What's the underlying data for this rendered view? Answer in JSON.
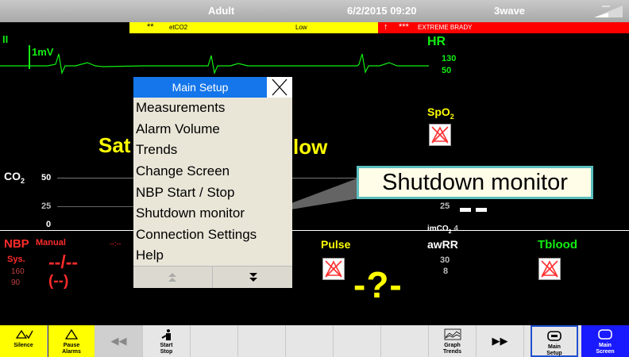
{
  "top_bar": {
    "patient_type": "Adult",
    "datetime": "6/2/2015 09:20",
    "waveform_mode": "3wave"
  },
  "alarms": {
    "yellow": {
      "stars": "**",
      "parameter": "etCO2",
      "condition": "Low"
    },
    "red": {
      "arrow": "↑",
      "stars": "***",
      "text": "EXTREME BRADY"
    }
  },
  "ecg": {
    "lead": "II",
    "scale": "1mV"
  },
  "hr": {
    "label": "HR",
    "high": "130",
    "low": "50"
  },
  "spo2": {
    "label": "SpO",
    "sub": "2"
  },
  "background_message": {
    "left": "Sat",
    "right": "low"
  },
  "co2": {
    "label": "CO",
    "sub": "2",
    "scale_top": "50",
    "scale_mid": "25",
    "scale_bottom": "0",
    "value": "25",
    "imco2_label": "imCO",
    "imco2_sub": "2",
    "imco2_value": "4"
  },
  "nbp": {
    "label": "NBP",
    "mode": "Manual",
    "time": "--:--",
    "sys_label": "Sys.",
    "high": "160",
    "low": "90",
    "value": "--/--",
    "mean": "(--)"
  },
  "pulse": {
    "label": "Pulse",
    "value": "-?-"
  },
  "awrr": {
    "label": "awRR",
    "high": "30",
    "low": "8"
  },
  "tblood": {
    "label": "Tblood"
  },
  "menu": {
    "title": "Main Setup",
    "items": [
      "Measurements",
      "Alarm Volume",
      "Trends",
      "Change Screen",
      "NBP Start / Stop",
      "Shutdown monitor",
      "Connection Settings",
      "Help"
    ]
  },
  "tooltip": "Shutdown monitor",
  "bottom_bar": {
    "silence": "Silence",
    "pause_alarms": [
      "Pause",
      "Alarms"
    ],
    "start_stop": [
      "Start",
      "Stop"
    ],
    "graph_trends": [
      "Graph",
      "Trends"
    ],
    "main_setup": [
      "Main",
      "Setup"
    ],
    "main_screen": [
      "Main",
      "Screen"
    ]
  },
  "colors": {
    "ecg": "#11ee11",
    "alarm_yellow": "#ffff00",
    "alarm_red": "#ff0000",
    "menu_title": "#1476ea",
    "main_screen": "#1a1aff"
  }
}
